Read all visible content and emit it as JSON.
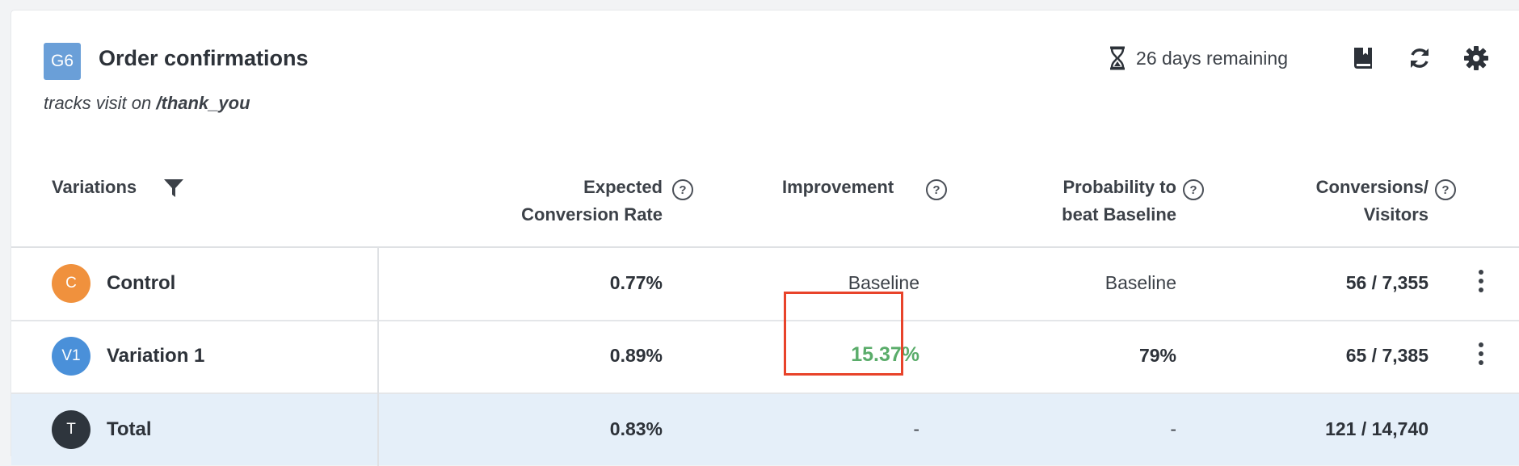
{
  "goal": {
    "badge": "G6",
    "title": "Order confirmations",
    "subtitle_prefix": "tracks visit on ",
    "subtitle_path": "/thank_you"
  },
  "toolbar": {
    "remaining": "26 days remaining",
    "icons": [
      "hourglass-icon",
      "book-icon",
      "refresh-icon",
      "gear-icon"
    ]
  },
  "table": {
    "headers": {
      "variations": "Variations",
      "expected_line1": "Expected",
      "expected_line2": "Conversion Rate",
      "improvement": "Improvement",
      "probability_line1": "Probability to",
      "probability_line2": "beat Baseline",
      "conversions_line1": "Conversions/",
      "conversions_line2": "Visitors",
      "help_glyph": "?"
    },
    "rows": [
      {
        "avatar": "C",
        "avatar_color": "#f0913d",
        "name": "Control",
        "rate": "0.77%",
        "improvement": "Baseline",
        "probability": "Baseline",
        "conversions": "56 / 7,355"
      },
      {
        "avatar": "V1",
        "avatar_color": "#4a90d9",
        "name": "Variation 1",
        "rate": "0.89%",
        "improvement": "15.37%",
        "probability": "79%",
        "conversions": "65 / 7,385"
      },
      {
        "avatar": "T",
        "avatar_color": "#2e353d",
        "name": "Total",
        "rate": "0.83%",
        "improvement": "-",
        "probability": "-",
        "conversions": "121 / 14,740"
      }
    ]
  },
  "colors": {
    "positive": "#5aac6a",
    "highlight": "#e8432a",
    "total_row_bg": "#e5eff9"
  }
}
